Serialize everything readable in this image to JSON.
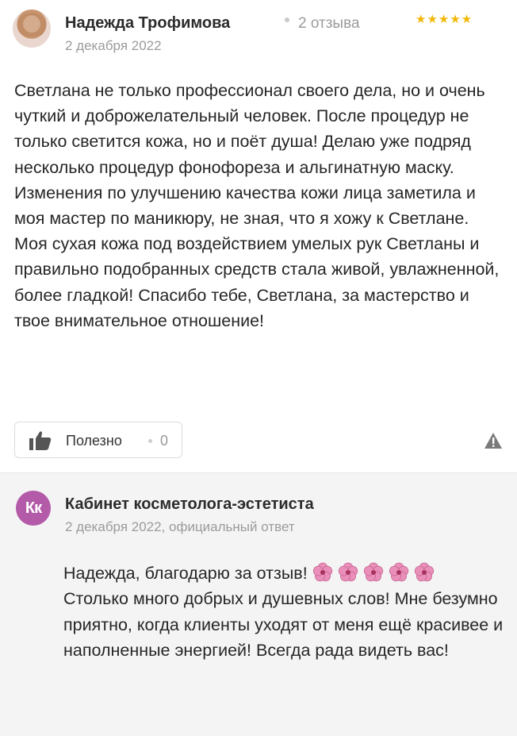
{
  "review": {
    "author": "Надежда Трофимова",
    "reviews_count": "2 отзыва",
    "rating": 5,
    "stars": "★★★★★",
    "date": "2 декабря 2022",
    "text": "Светлана не только профессионал своего дела, но и очень чуткий и доброжелательный человек. После процедур не только светится кожа, но и поёт душа! Делаю уже подряд несколько процедур фонофореза и альгинатную маску. Изменения по улучшению качества кожи лица заметила и моя мастер по маникюру, не зная, что я хожу к Светлане. Моя сухая кожа под воздействием умелых рук Светланы и правильно подобранных средств стала живой, увлажненной, более гладкой! Спасибо тебе, Светлана, за мастерство и твое внимательное отношение!",
    "helpful_label": "Полезно",
    "helpful_count": "0",
    "icons": {
      "helpful": "thumbs-up-icon",
      "report": "warning-icon"
    }
  },
  "reply": {
    "avatar_initials": "Кк",
    "author": "Кабинет косметолога-эстетиста",
    "meta": "2 декабря 2022, официальный ответ",
    "text_before_emoji": "Надежда, благодарю за отзыв!",
    "emoji_name": "hibiscus-flower-icon",
    "emoji_count": 5,
    "text_after_emoji": "Столько много добрых и душевных слов! Мне безумно приятно, когда клиенты уходят от меня ещё красивее и наполненные энергией! Всегда рада видеть вас!"
  },
  "colors": {
    "star": "#f2b705",
    "reply_background": "#f4f4f4",
    "reply_avatar": "#b35aa9",
    "muted_text": "#9b9b9b"
  }
}
